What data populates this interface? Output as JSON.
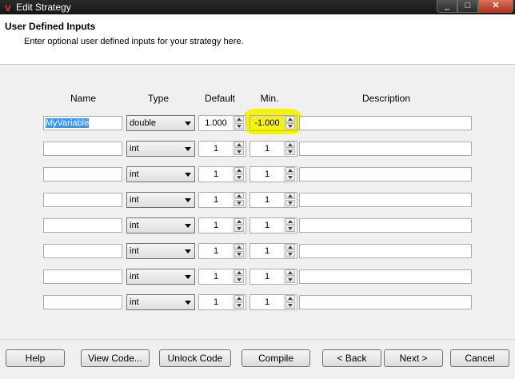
{
  "window": {
    "title": "Edit Strategy",
    "min_glyph": "_",
    "max_glyph": "□",
    "close_glyph": "✕"
  },
  "header": {
    "title": "User Defined Inputs",
    "subtitle": "Enter optional user defined inputs for your strategy here."
  },
  "columns": {
    "name": "Name",
    "type": "Type",
    "default": "Default",
    "min": "Min.",
    "description": "Description"
  },
  "rows": [
    {
      "name": "MyVariable",
      "type": "double",
      "default": "1.000",
      "min": "-1.000",
      "description": ""
    },
    {
      "name": "",
      "type": "int",
      "default": "1",
      "min": "1",
      "description": ""
    },
    {
      "name": "",
      "type": "int",
      "default": "1",
      "min": "1",
      "description": ""
    },
    {
      "name": "",
      "type": "int",
      "default": "1",
      "min": "1",
      "description": ""
    },
    {
      "name": "",
      "type": "int",
      "default": "1",
      "min": "1",
      "description": ""
    },
    {
      "name": "",
      "type": "int",
      "default": "1",
      "min": "1",
      "description": ""
    },
    {
      "name": "",
      "type": "int",
      "default": "1",
      "min": "1",
      "description": ""
    },
    {
      "name": "",
      "type": "int",
      "default": "1",
      "min": "1",
      "description": ""
    }
  ],
  "buttons": {
    "help": "Help",
    "view_code": "View Code...",
    "unlock_code": "Unlock Code",
    "compile": "Compile",
    "back": "< Back",
    "next": "Next >",
    "cancel": "Cancel"
  },
  "colors": {
    "highlight": "#f4f40a",
    "selection": "#3399ff",
    "close_button": "#c8432b"
  },
  "icons": {
    "app": "strategy-app-icon"
  }
}
